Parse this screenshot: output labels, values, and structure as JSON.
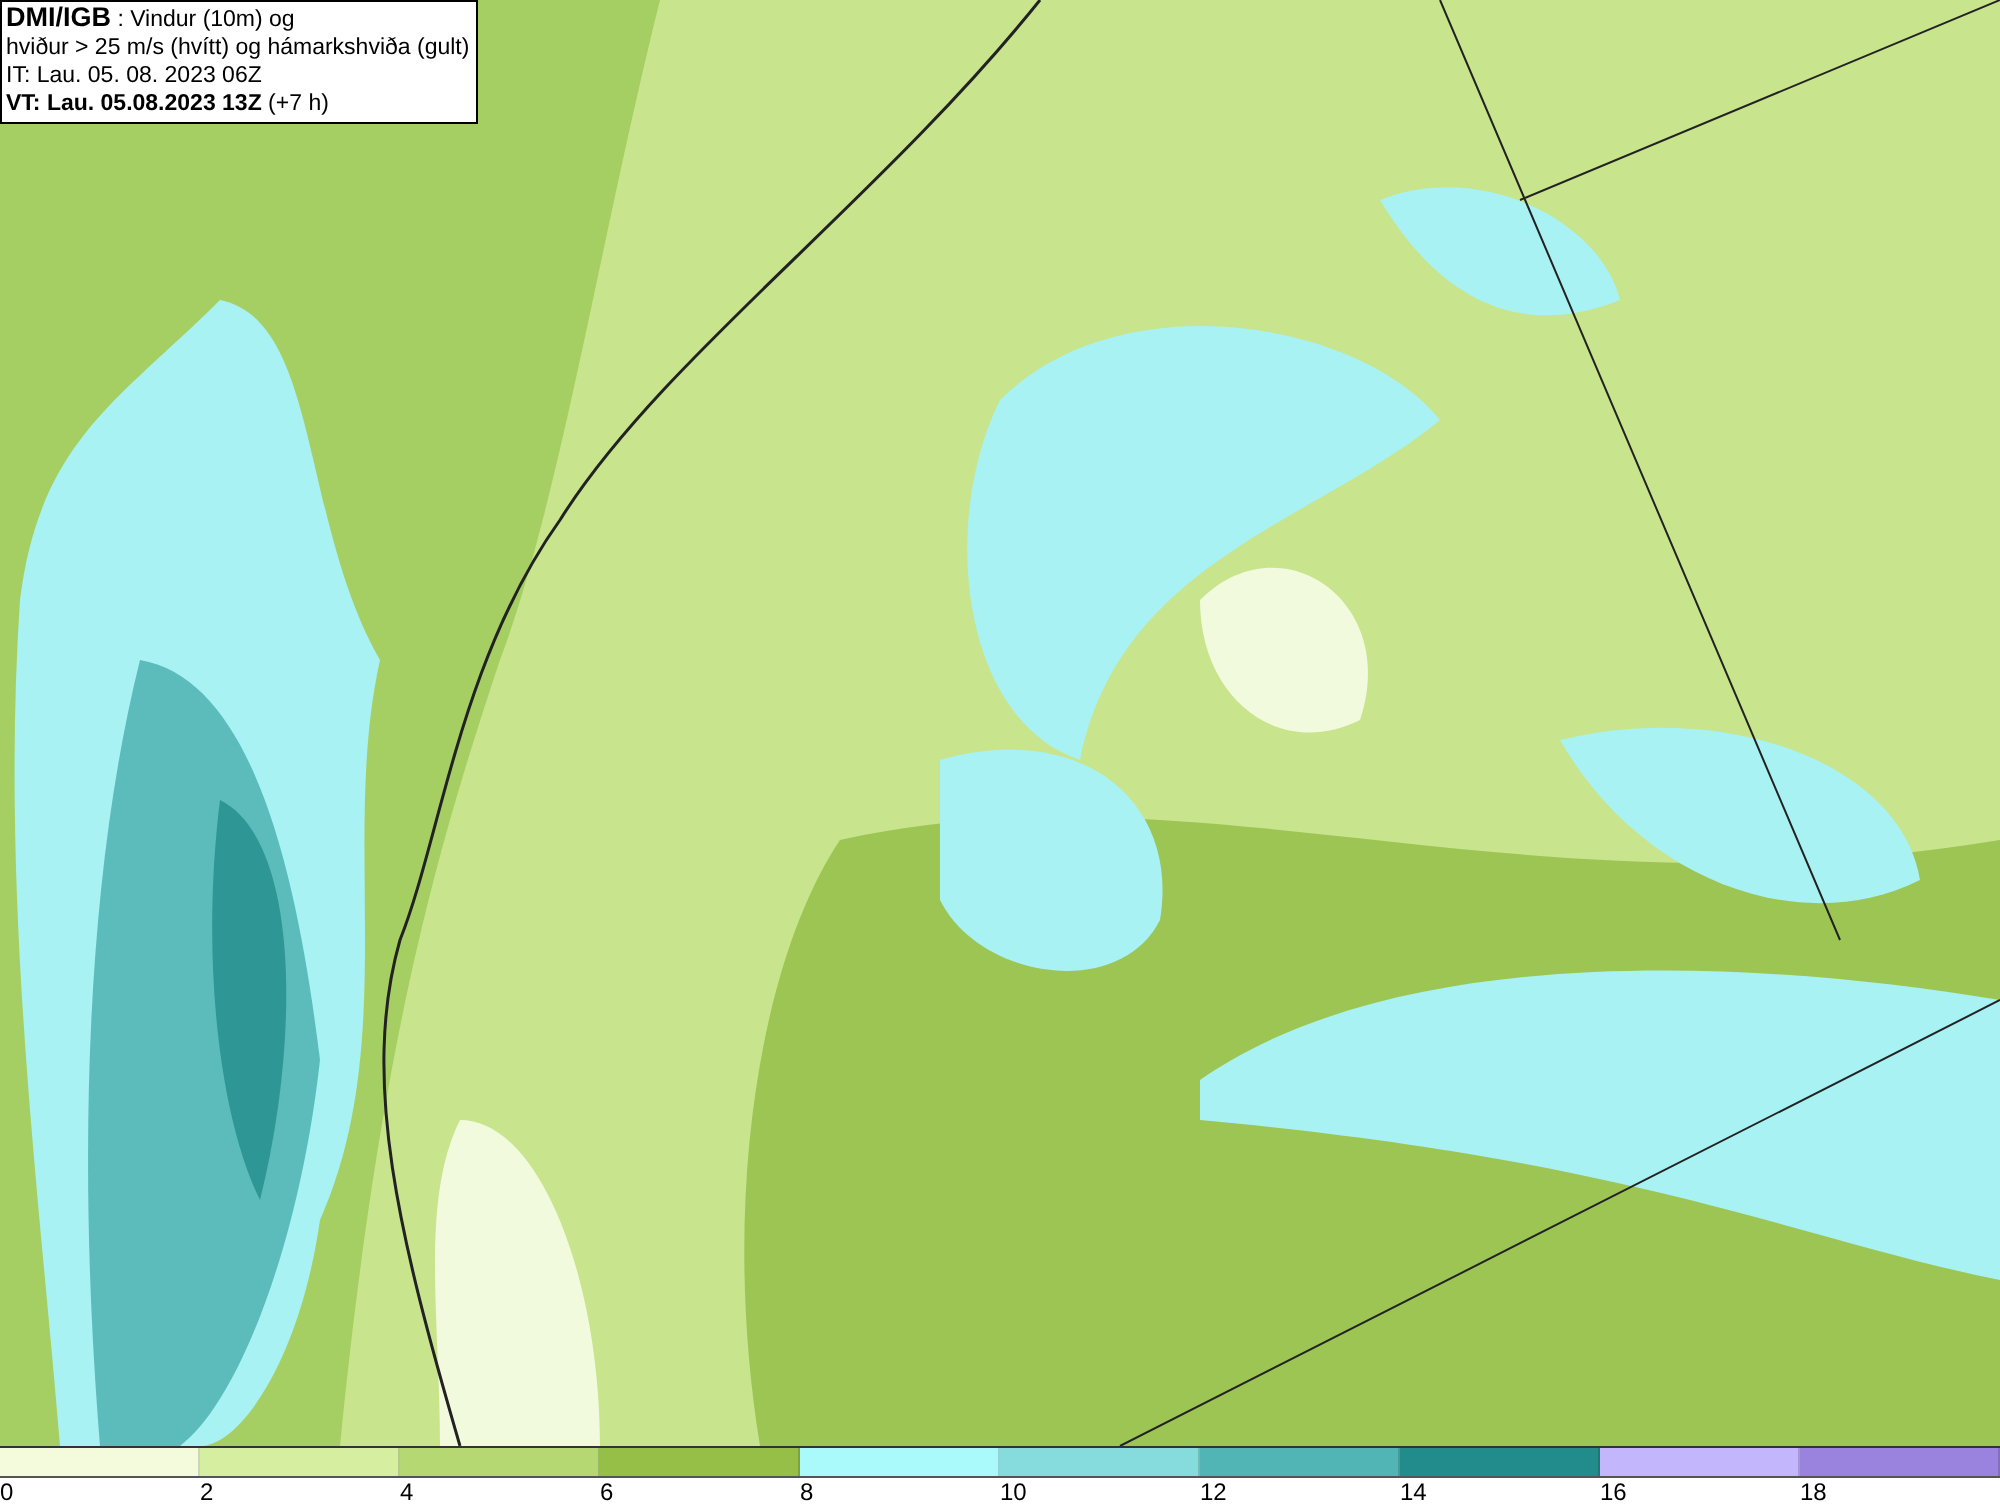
{
  "title_box": {
    "lines": [
      "**DMI/IGB** : Vindur (10m) og",
      "hviður > 25 m/s (hvítt) og hámarkshviða (gult)",
      "IT: Lau. 05. 08. 2023 06Z",
      "**VT: Lau. 05.08.2023 13Z** (+7 h)"
    ]
  },
  "colorbar": [
    {
      "color": "#f4fbdc",
      "label": "0"
    },
    {
      "color": "#d5eea0",
      "label": "2"
    },
    {
      "color": "#b5d873",
      "label": "4"
    },
    {
      "color": "#96bf47",
      "label": "6"
    },
    {
      "color": "#aafafc",
      "label": "8"
    },
    {
      "color": "#86dcdc",
      "label": "10"
    },
    {
      "color": "#52b5b5",
      "label": "12"
    },
    {
      "color": "#228c8c",
      "label": "14"
    },
    {
      "color": "#c3b6fc",
      "label": "16"
    },
    {
      "color": "#9a83df",
      "label": "18"
    }
  ]
}
